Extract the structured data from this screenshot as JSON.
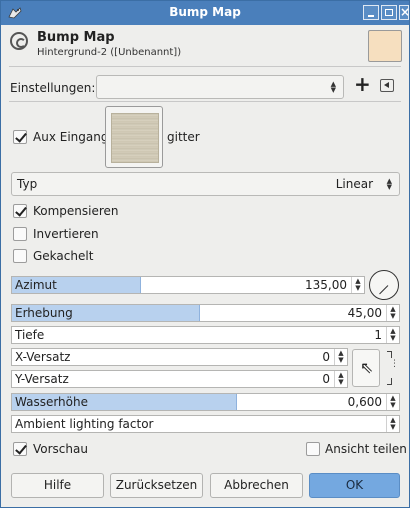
{
  "window": {
    "title": "Bump Map"
  },
  "header": {
    "title": "Bump Map",
    "subtitle": "Hintergrund-2 ([Unbenannt])",
    "swatch_color": "#f6dfbf"
  },
  "settings": {
    "label": "Einstellungen:",
    "value": ""
  },
  "aux": {
    "label": "Aux Eingang",
    "checked": true,
    "after_label": "gitter"
  },
  "type_combo": {
    "label": "Typ",
    "value": "Linear"
  },
  "checks": {
    "kompensieren": {
      "label": "Kompensieren",
      "checked": true
    },
    "invertieren": {
      "label": "Invertieren",
      "checked": false
    },
    "gekachelt": {
      "label": "Gekachelt",
      "checked": false
    }
  },
  "params": {
    "azimut": {
      "label": "Azimut",
      "value": "135,00",
      "fill_percent": 37.5
    },
    "erhebung": {
      "label": "Erhebung",
      "value": "45,00",
      "fill_percent": 53
    },
    "tiefe": {
      "label": "Tiefe",
      "value": "1",
      "fill_percent": 0
    },
    "x_versatz": {
      "label": "X-Versatz",
      "value": "0",
      "fill_percent": 0
    },
    "y_versatz": {
      "label": "Y-Versatz",
      "value": "0",
      "fill_percent": 0
    },
    "wasserhoehe": {
      "label": "Wasserhöhe",
      "value": "0,600",
      "fill_percent": 60
    },
    "ambient": {
      "label": "Ambient lighting factor",
      "value": "",
      "fill_percent": 0
    }
  },
  "preview": {
    "label": "Vorschau",
    "checked": true
  },
  "split": {
    "label": "Ansicht teilen",
    "checked": false
  },
  "buttons": {
    "help": "Hilfe",
    "reset": "Zurücksetzen",
    "cancel": "Abbrechen",
    "ok": "OK"
  },
  "colors": {
    "titlebar": "#4a7fbb",
    "accent": "#74a8e0",
    "slider_fill": "#b8d1ee"
  }
}
